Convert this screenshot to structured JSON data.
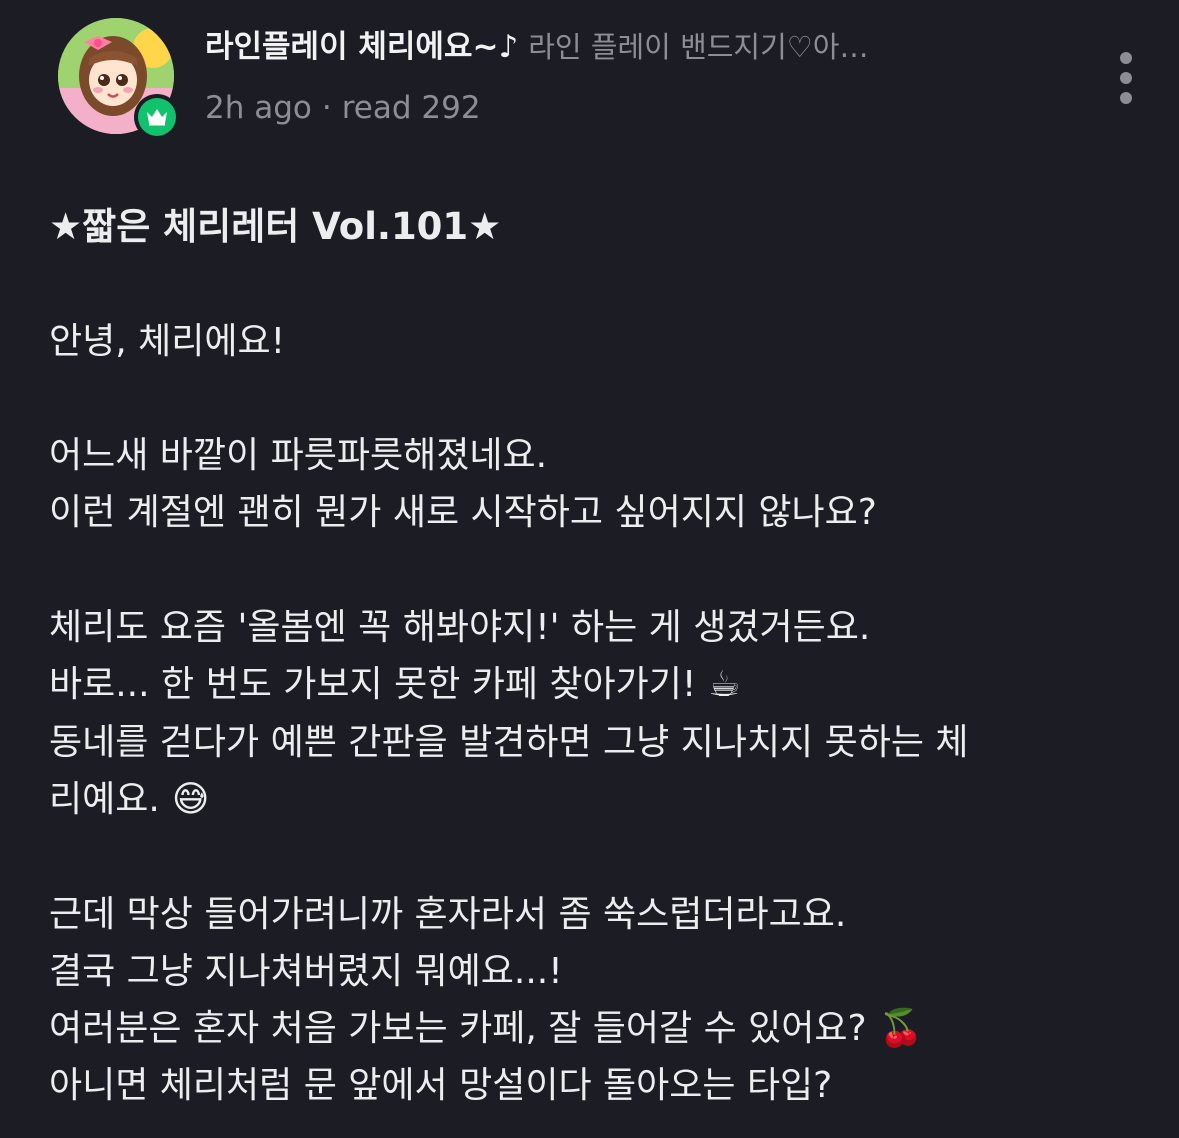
{
  "post": {
    "author": "라인플레이 체리에요~♪",
    "band": "라인 플레이 밴드지기♡아…",
    "time": "2h ago",
    "separator": "·",
    "reads": "read 292"
  },
  "content": {
    "title": "★짧은 체리레터 Vol.101★",
    "lines": [
      "안녕, 체리에요!",
      "어느새 바깥이 파릇파릇해졌네요.",
      "이런 계절엔 괜히 뭔가 새로 시작하고 싶어지지 않나요?",
      "체리도 요즘 '올봄엔 꼭 해봐야지!' 하는 게 생겼거든요.",
      "바로... 한 번도 가보지 못한 카페 찾아가기!",
      "동네를 걷다가 예쁜 간판을 발견하면 그냥 지나치지 못하는 체",
      "리예요.",
      "근데 막상 들어가려니까 혼자라서 좀 쑥스럽더라고요.",
      "결국 그냥 지나쳐버렸지 뭐예요...!",
      "여러분은 혼자 처음 가보는 카페, 잘 들어갈 수 있어요?",
      "아니면 체리처럼 문 앞에서 망설이다 돌아오는 타입?"
    ],
    "emojis": {
      "coffee": "☕",
      "sweat_smile": "😅",
      "cherries": "🍒"
    }
  },
  "icons": {
    "badge": "crown-icon",
    "more": "more-vertical-icon",
    "badge_color": "#11c26d"
  }
}
